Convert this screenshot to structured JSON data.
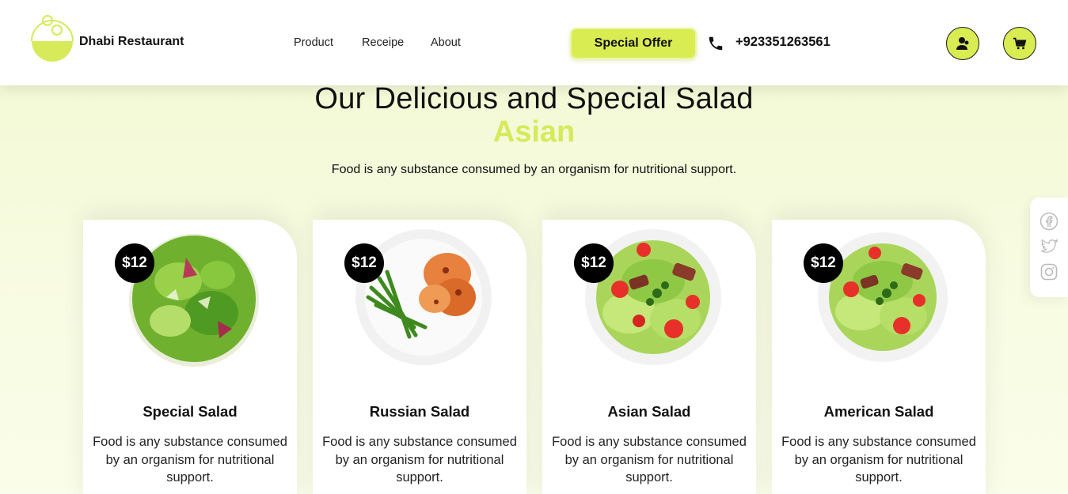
{
  "header": {
    "brand": "Dhabi Restaurant",
    "nav": [
      {
        "label": "Product"
      },
      {
        "label": "Receipe"
      },
      {
        "label": "About"
      }
    ],
    "offer_label": "Special Offer",
    "phone": "+923351263561",
    "icons": {
      "phone": "phone-icon",
      "user": "user-icon",
      "cart": "cart-icon"
    },
    "accent": "#d9ec52"
  },
  "hero": {
    "title": "Our Delicious and Special Salad",
    "subtitle": "Asian",
    "description": "Food is any substance consumed by an organism for nutritional support."
  },
  "cards": [
    {
      "price": "$12",
      "name": "Special Salad",
      "description": "Food is any substance consumed by an organism for nutritional support."
    },
    {
      "price": "$12",
      "name": "Russian Salad",
      "description": "Food is any substance consumed by an organism for nutritional support."
    },
    {
      "price": "$12",
      "name": "Asian Salad",
      "description": "Food is any substance consumed by an organism for nutritional support."
    },
    {
      "price": "$12",
      "name": "American Salad",
      "description": "Food is any substance consumed by an organism for nutritional support."
    }
  ],
  "social": [
    "facebook-icon",
    "twitter-icon",
    "instagram-icon"
  ]
}
